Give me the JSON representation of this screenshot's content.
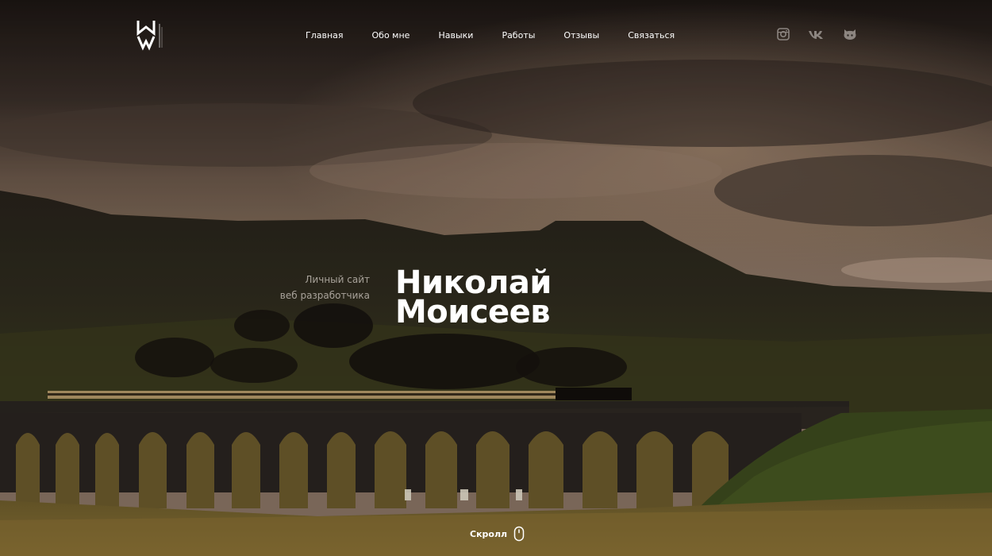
{
  "nav": {
    "items": [
      {
        "label": "Главная"
      },
      {
        "label": "Обо мне"
      },
      {
        "label": "Навыки"
      },
      {
        "label": "Работы"
      },
      {
        "label": "Отзывы"
      },
      {
        "label": "Связаться"
      }
    ]
  },
  "logo": {
    "icon": "mw-monogram-logo",
    "vertical_text": "MOISEEV"
  },
  "socials": [
    {
      "icon": "instagram-icon"
    },
    {
      "icon": "vk-icon"
    },
    {
      "icon": "github-icon"
    }
  ],
  "hero": {
    "subtitle_line1": "Личный сайт",
    "subtitle_line2": "веб разработчика",
    "name_line1": "Николай",
    "name_line2": "Моисеев"
  },
  "scroll": {
    "label": "Скролл",
    "icon": "mouse-icon"
  },
  "colors": {
    "text": "#ffffff",
    "subtitle": "#a8a29a",
    "sky": "#5a4a3e",
    "ground": "#3a3818"
  }
}
